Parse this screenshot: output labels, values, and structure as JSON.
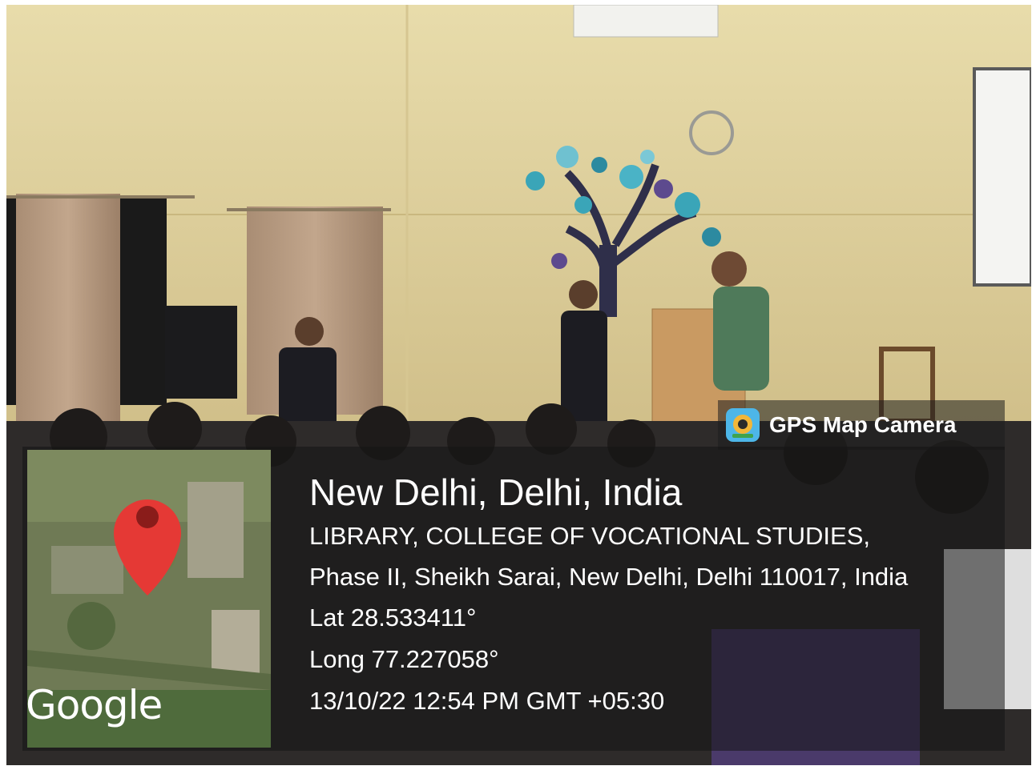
{
  "overlay": {
    "app_name": "GPS Map Camera",
    "city": "New Delhi, Delhi, India",
    "address_line1": "LIBRARY, COLLEGE OF VOCATIONAL STUDIES,",
    "address_line2": "Phase II, Sheikh Sarai, New Delhi, Delhi 110017, India",
    "latitude": "Lat 28.533411°",
    "longitude": "Long 77.227058°",
    "timestamp": "13/10/22 12:54 PM GMT +05:30",
    "map_attribution": "Google",
    "pin_color": "#e53935"
  },
  "scene": {
    "wall_color": "#e6d7a4",
    "curtain_color": "#b79a80"
  }
}
